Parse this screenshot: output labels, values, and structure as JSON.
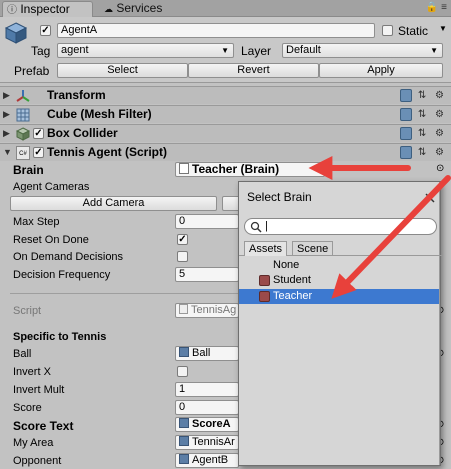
{
  "tabs": {
    "inspector": "Inspector",
    "services": "Services"
  },
  "header": {
    "name_value": "AgentA",
    "static_label": "Static",
    "tag_label": "Tag",
    "tag_value": "agent",
    "layer_label": "Layer",
    "layer_value": "Default",
    "prefab_label": "Prefab",
    "select_label": "Select",
    "revert_label": "Revert",
    "apply_label": "Apply"
  },
  "components": {
    "transform": "Transform",
    "cube_filter": "Cube (Mesh Filter)",
    "box_collider": "Box Collider",
    "tennis_agent": "Tennis Agent (Script)"
  },
  "agent": {
    "brain_label": "Brain",
    "brain_value": "Teacher (Brain)",
    "agent_cameras_label": "Agent Cameras",
    "add_camera_label": "Add Camera",
    "max_step_label": "Max Step",
    "max_step_value": "0",
    "reset_on_done_label": "Reset On Done",
    "on_demand_label": "On Demand Decisions",
    "decision_freq_label": "Decision Frequency",
    "decision_freq_value": "5",
    "script_label": "Script",
    "script_value": "TennisAg",
    "specific_label": "Specific to Tennis",
    "ball_label": "Ball",
    "ball_value": "Ball",
    "invert_x_label": "Invert X",
    "invert_mult_label": "Invert Mult",
    "invert_mult_value": "1",
    "score_label": "Score",
    "score_value": "0",
    "score_text_label": "Score Text",
    "score_text_value": "ScoreA",
    "my_area_label": "My Area",
    "my_area_value": "TennisAr",
    "opponent_label": "Opponent",
    "opponent_value": "AgentB"
  },
  "popup": {
    "title": "Select Brain",
    "search_placeholder": "",
    "tab_assets": "Assets",
    "tab_scene": "Scene",
    "items": [
      "None",
      "Student",
      "Teacher"
    ],
    "selected": "Teacher"
  },
  "colors": {
    "arrow": "#e8413b",
    "selection": "#3d79d0"
  }
}
